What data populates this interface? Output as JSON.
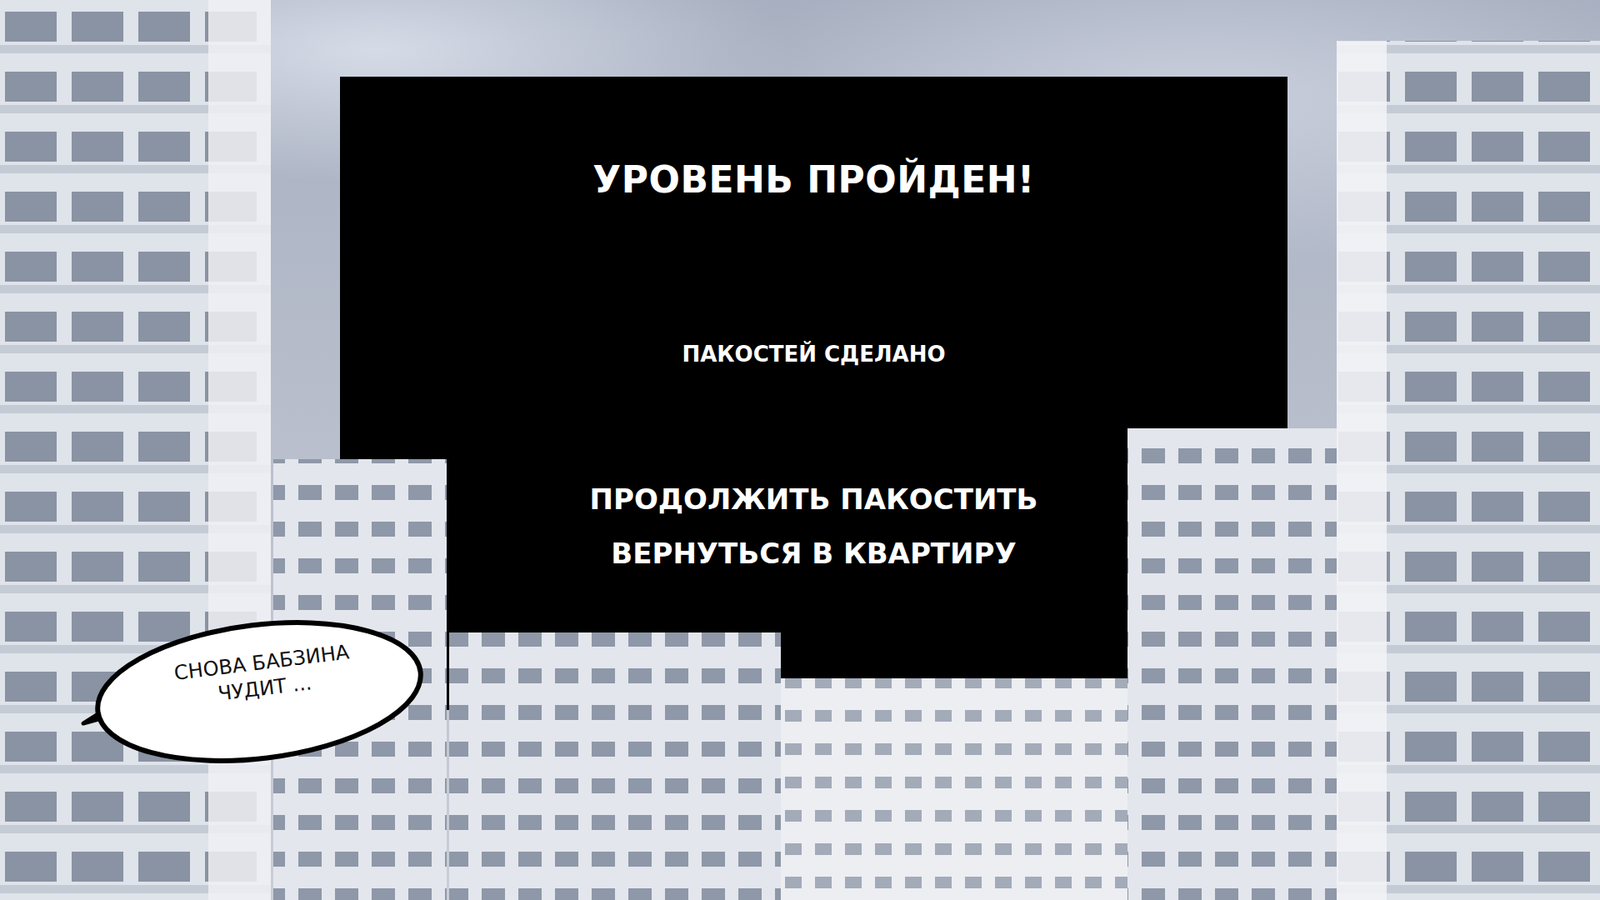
{
  "screen": {
    "title": "УРОВЕНЬ ПРОЙДЕН!",
    "stat_label": "ПАКОСТЕЙ СДЕЛАНО",
    "menu": [
      {
        "label": "ПРОДОЛЖИТЬ ПАКОСТИТЬ"
      },
      {
        "label": "ВЕРНУТЬСЯ В КВАРТИРУ"
      }
    ],
    "speech_bubble": "СНОВА БАБЗИНА ЧУДИТ ..."
  }
}
